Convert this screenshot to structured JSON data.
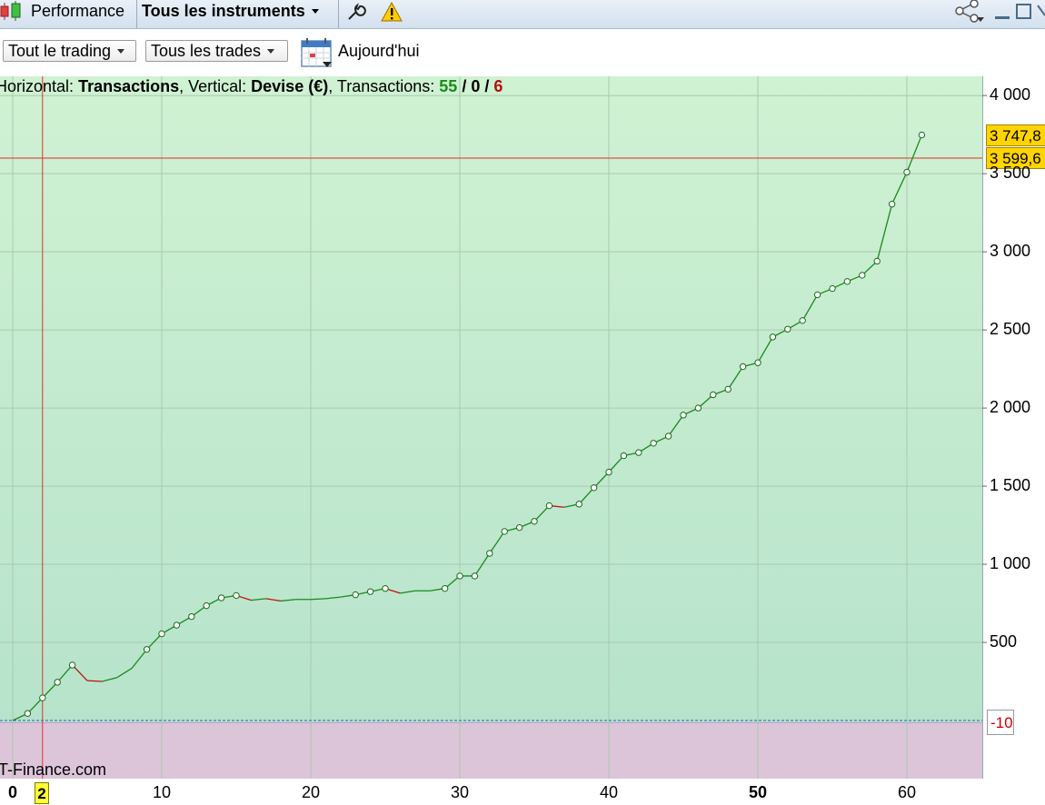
{
  "topbar": {
    "performance_label": "Performance",
    "instruments_label": "Tous les instruments"
  },
  "toolbar": {
    "trading_filter": "Tout le trading",
    "trades_filter": "Tous les trades",
    "date_label": "Aujourd'hui"
  },
  "info": {
    "horizontal_label": "Horizontal:",
    "horizontal_value": "Transactions",
    "vertical_label": ", Vertical:",
    "vertical_value": "Devise (€)",
    "transactions_label": ", Transactions:",
    "winning": "55",
    "sep1": "/",
    "neutral": "0",
    "sep2": "/",
    "losing": "6"
  },
  "watermark": "T-Finance.com",
  "price_tags": {
    "last": "3 747,8",
    "cursor": "3 599,6"
  },
  "negative_tag": "-10",
  "cursor_x_label": "2",
  "colors": {
    "up": "#1a8a1a",
    "down": "#c01010",
    "cursor": "#e03030",
    "tag": "#ffd400"
  },
  "chart_data": {
    "type": "line",
    "title": "",
    "xlabel": "",
    "ylabel": "",
    "xlim": [
      0,
      65
    ],
    "ylim": [
      -130,
      4100
    ],
    "x_ticks": [
      "0",
      "10",
      "20",
      "30",
      "40",
      "50",
      "60"
    ],
    "y_ticks": [
      "500",
      "1 000",
      "1 500",
      "2 000",
      "2 500",
      "3 000",
      "3 500",
      "4 000"
    ],
    "y_tick_values": [
      500,
      1000,
      1500,
      2000,
      2500,
      3000,
      3500,
      4000
    ],
    "cursor": {
      "x": 2,
      "y": 3599.6
    },
    "series": [
      {
        "values": [
          [
            0,
            0
          ],
          [
            1,
            45
          ],
          [
            2,
            145
          ],
          [
            3,
            245
          ],
          [
            4,
            355
          ],
          [
            5,
            255
          ],
          [
            6,
            250
          ],
          [
            7,
            275
          ],
          [
            8,
            335
          ],
          [
            9,
            455
          ],
          [
            10,
            555
          ],
          [
            11,
            610
          ],
          [
            12,
            665
          ],
          [
            13,
            735
          ],
          [
            14,
            785
          ],
          [
            15,
            800
          ],
          [
            16,
            770
          ],
          [
            17,
            780
          ],
          [
            18,
            765
          ],
          [
            19,
            775
          ],
          [
            20,
            775
          ],
          [
            21,
            780
          ],
          [
            22,
            790
          ],
          [
            23,
            805
          ],
          [
            24,
            825
          ],
          [
            25,
            845
          ],
          [
            26,
            815
          ],
          [
            27,
            830
          ],
          [
            28,
            830
          ],
          [
            29,
            845
          ],
          [
            30,
            925
          ],
          [
            31,
            925
          ],
          [
            32,
            1070
          ],
          [
            33,
            1210
          ],
          [
            34,
            1235
          ],
          [
            35,
            1275
          ],
          [
            36,
            1375
          ],
          [
            37,
            1365
          ],
          [
            38,
            1385
          ],
          [
            39,
            1490
          ],
          [
            40,
            1590
          ],
          [
            41,
            1695
          ],
          [
            42,
            1715
          ],
          [
            43,
            1775
          ],
          [
            44,
            1820
          ],
          [
            45,
            1955
          ],
          [
            46,
            2000
          ],
          [
            47,
            2085
          ],
          [
            48,
            2120
          ],
          [
            49,
            2265
          ],
          [
            50,
            2290
          ],
          [
            51,
            2455
          ],
          [
            52,
            2505
          ],
          [
            53,
            2560
          ],
          [
            54,
            2725
          ],
          [
            55,
            2765
          ],
          [
            56,
            2810
          ],
          [
            57,
            2850
          ],
          [
            58,
            2940
          ],
          [
            59,
            3305
          ],
          [
            60,
            3510
          ],
          [
            61,
            3747.8
          ]
        ]
      }
    ]
  }
}
